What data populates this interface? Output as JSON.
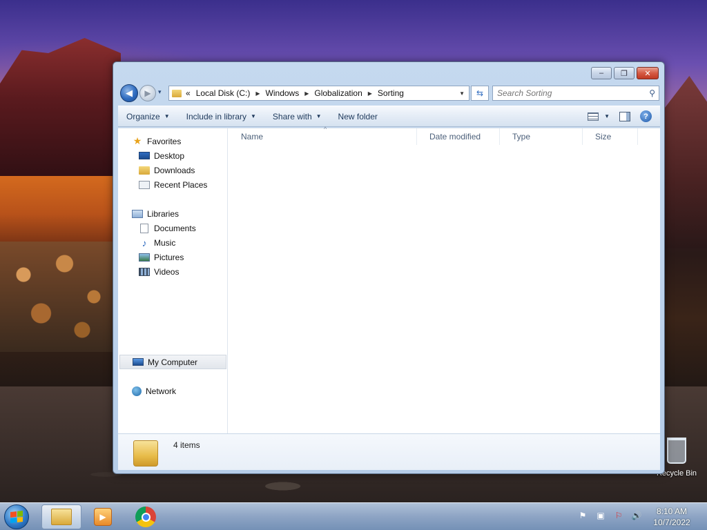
{
  "colors": {
    "accent": "#2f6cc0",
    "toolbar_text": "#1e395b",
    "header_text": "#4c607a",
    "close_button": "#c03a24"
  },
  "window": {
    "controls": {
      "minimize": "–",
      "maximize": "❐",
      "close": "✕"
    }
  },
  "nav": {
    "back_icon": "◀",
    "forward_icon": "▶",
    "history_dropdown": "▾",
    "address_overflow": "«",
    "breadcrumbs": [
      "Local Disk (C:)",
      "Windows",
      "Globalization",
      "Sorting"
    ],
    "crumb_separator": "▶",
    "address_dropdown": "▼",
    "refresh_icon": "⇆",
    "search_placeholder": "Search Sorting",
    "search_icon": "⚲"
  },
  "toolbar": {
    "organize": "Organize",
    "include_in_library": "Include in library",
    "share_with": "Share with",
    "new_folder": "New folder",
    "dropdown_arrow": "▼",
    "help": "?"
  },
  "navpane": {
    "favorites": {
      "label": "Favorites",
      "items": [
        "Desktop",
        "Downloads",
        "Recent Places"
      ]
    },
    "libraries": {
      "label": "Libraries",
      "items": [
        "Documents",
        "Music",
        "Pictures",
        "Videos"
      ]
    },
    "computer": {
      "label": "My Computer"
    },
    "network": {
      "label": "Network"
    }
  },
  "content": {
    "columns": [
      "Name",
      "Date modified",
      "Type",
      "Size"
    ],
    "sort_indicator": "^"
  },
  "details": {
    "item_count": "4 items"
  },
  "desktop": {
    "recycle_bin": "Recycle Bin"
  },
  "taskbar": {
    "clock_time": "8:10 AM",
    "clock_date": "10/7/2022",
    "media_icon": "▶",
    "tray": {
      "action_center": "⚑",
      "network": "▣",
      "volume": "🔊",
      "flag": "⚐"
    }
  }
}
